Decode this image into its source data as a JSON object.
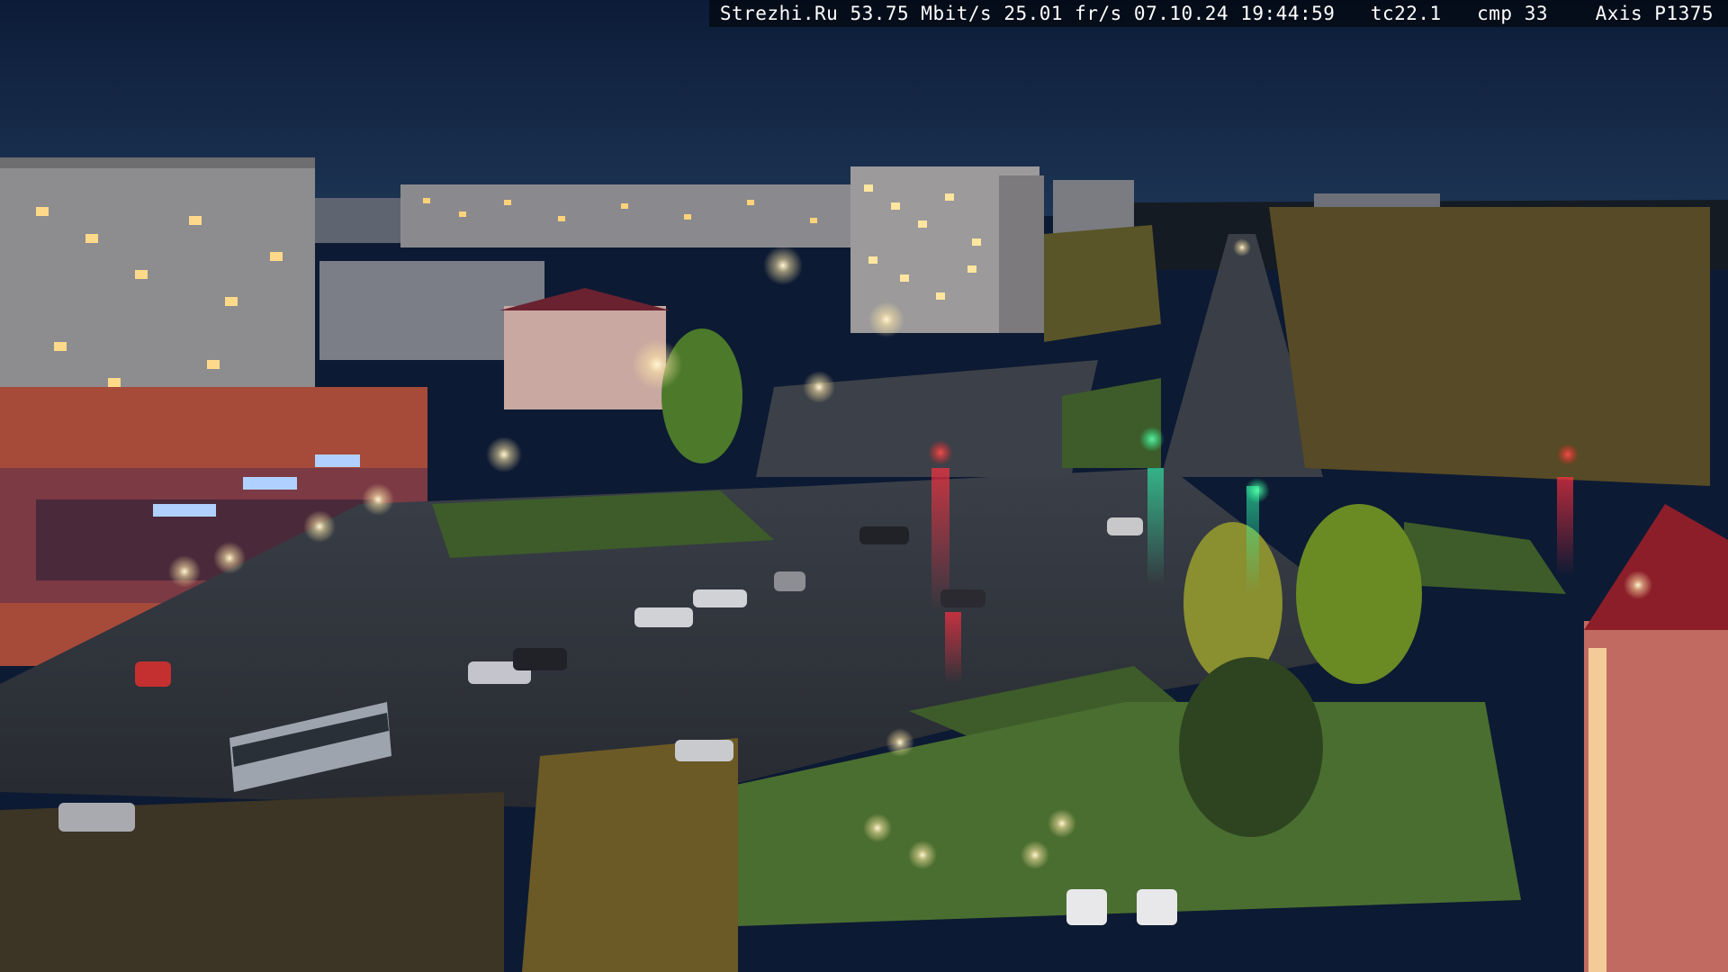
{
  "overlay": {
    "site": "Strezhi.Ru",
    "bitrate": "53.75 Mbit/s",
    "framerate": "25.01 fr/s",
    "date": "07.10.24",
    "time": "19:44:59",
    "tc": "tc22.1",
    "cmp": "cmp 33",
    "camera": "Axis P1375"
  },
  "scene": {
    "sky_color": "#102544",
    "horizon_color": "#1b3457",
    "road_color": "#2c3038",
    "lawn_color": "#3a5a2a",
    "building_light_color": "#ffd27a",
    "traffic_light_red": "#ff3030",
    "traffic_light_green": "#30ff90"
  }
}
